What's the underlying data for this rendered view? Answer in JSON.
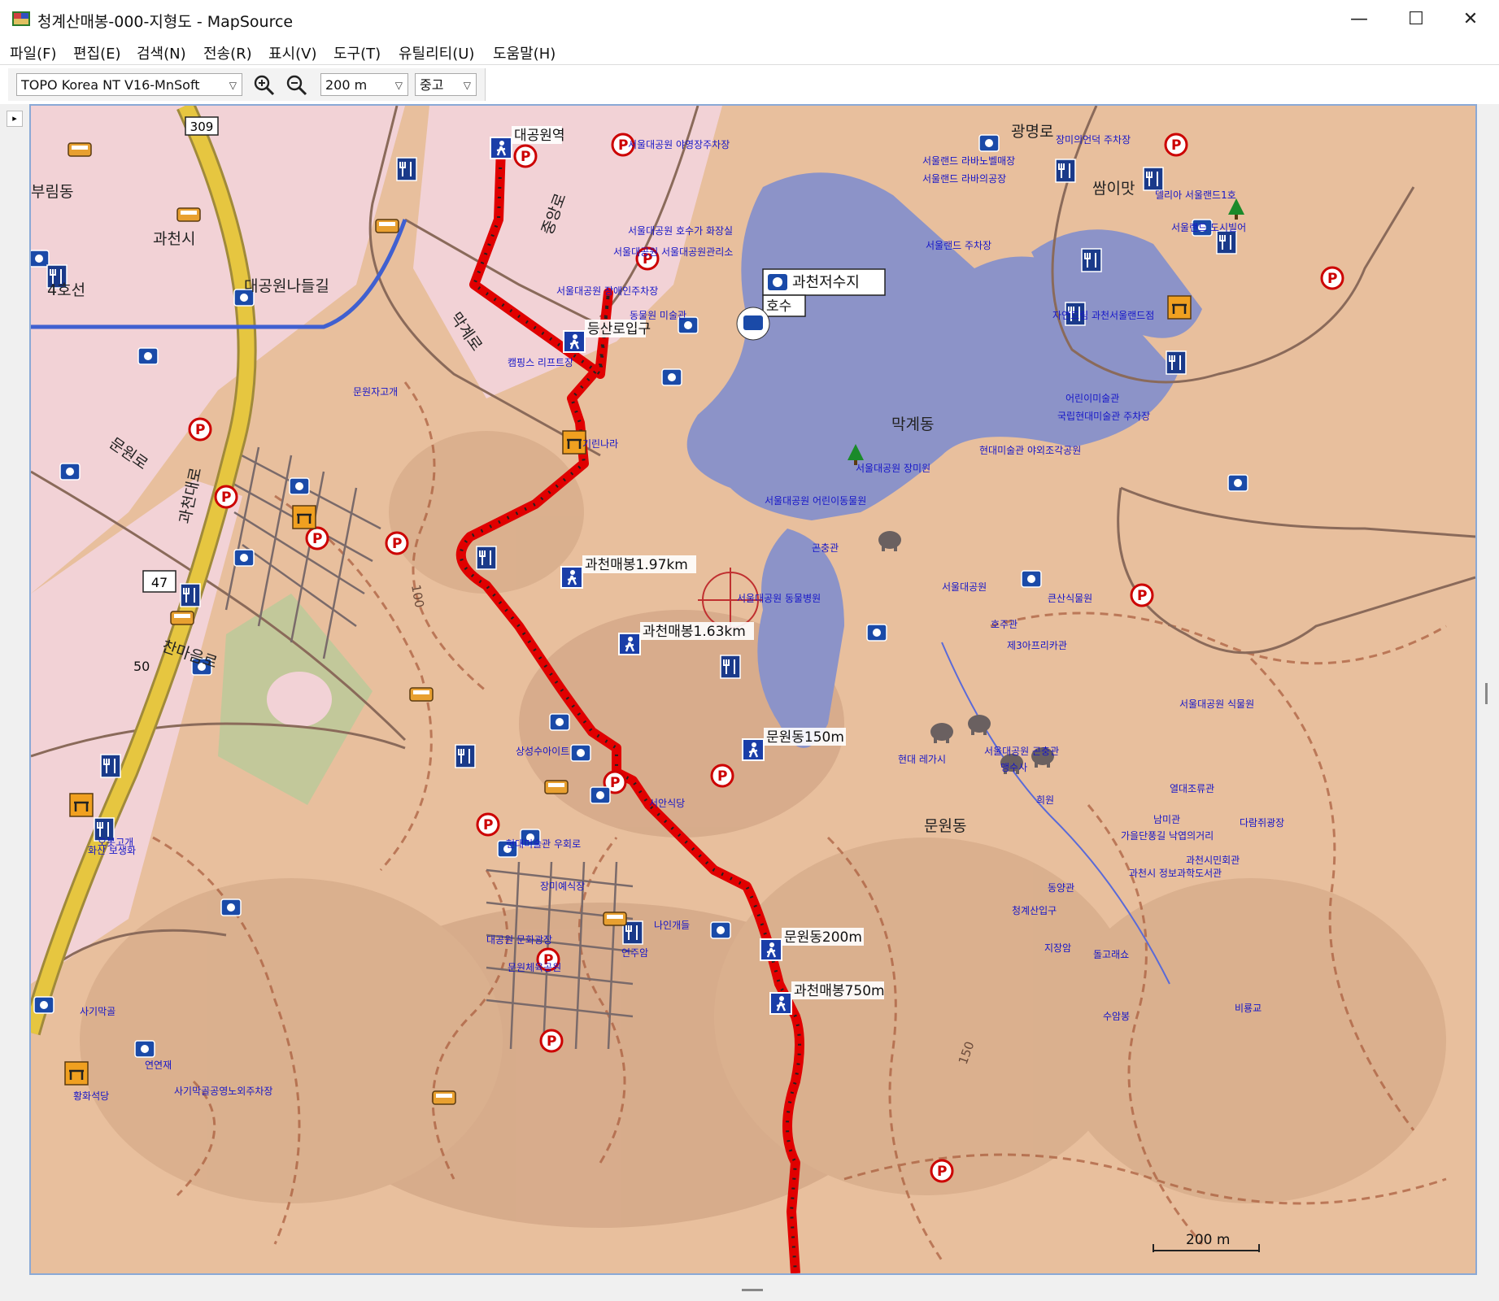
{
  "window": {
    "title": "청계산매봉-000-지형도 - MapSource",
    "minimize_glyph": "—",
    "maximize_glyph": "☐",
    "close_glyph": "✕"
  },
  "menu": [
    {
      "label": "파일(F)"
    },
    {
      "label": "편집(E)"
    },
    {
      "label": "검색(N)"
    },
    {
      "label": "전송(R)"
    },
    {
      "label": "표시(V)"
    },
    {
      "label": "도구(T)"
    },
    {
      "label": "유틸리티(U)"
    },
    {
      "label": "도움말(H)"
    }
  ],
  "toolbar": {
    "map_product": "TOPO Korea NT V16-MnSoft",
    "zoom_in_icon": "zoom-in-icon",
    "zoom_out_icon": "zoom-out-icon",
    "zoom_scale": "200 m",
    "detail_level": "중고"
  },
  "colors": {
    "terrain": "#e8bf9d",
    "urban": "#f2d2d6",
    "water": "#8c93c8",
    "track": "#e00000",
    "highway": "#e6c640",
    "subway": "#4060d0",
    "poi_text": "#1616c8"
  },
  "map": {
    "scale_label": "200 m",
    "waypoints": [
      {
        "label": "대공원역"
      },
      {
        "label": "등산로입구"
      },
      {
        "label": "과천매봉1.97km"
      },
      {
        "label": "과천매봉1.63km"
      },
      {
        "label": "문원동150m"
      },
      {
        "label": "문원동200m"
      },
      {
        "label": "과천매봉750m"
      }
    ],
    "callouts": [
      {
        "label": "과천저수지"
      },
      {
        "label": "호수"
      }
    ],
    "place_labels": [
      {
        "label": "과천시"
      },
      {
        "label": "부림동"
      },
      {
        "label": "막계동"
      },
      {
        "label": "문원동"
      },
      {
        "label": "광명로"
      },
      {
        "label": "쌈이맛"
      },
      {
        "label": "4호선"
      },
      {
        "label": "대공원나들길"
      },
      {
        "label": "과천대로"
      },
      {
        "label": "문원로"
      },
      {
        "label": "찬마음로"
      },
      {
        "label": "막계로"
      },
      {
        "label": "중앙로"
      }
    ],
    "route_shields": [
      {
        "label": "309"
      },
      {
        "label": "47"
      },
      {
        "label": "50"
      }
    ],
    "contour_labels": [
      {
        "label": "100"
      },
      {
        "label": "150"
      }
    ],
    "poi_labels": [
      {
        "label": "서울대공원 야영장주차장"
      },
      {
        "label": "서울대공원 호수가 화장실"
      },
      {
        "label": "서울대공원 서울대공원관리소"
      },
      {
        "label": "서울대공원 장애인주차장"
      },
      {
        "label": "동물원 미술관"
      },
      {
        "label": "캠핑스 리프트장"
      },
      {
        "label": "서울랜드 라바노벨매장"
      },
      {
        "label": "서울랜드 라바의공장"
      },
      {
        "label": "서울랜드 주차장"
      },
      {
        "label": "장미의언덕 주차장"
      },
      {
        "label": "델리아 서울랜드1호"
      },
      {
        "label": "서울랜드 도시빌어"
      },
      {
        "label": "자연드림 과천서울랜드점"
      },
      {
        "label": "어린이미술관"
      },
      {
        "label": "국립현대미술관 주차장"
      },
      {
        "label": "현대미술관 야외조각공원"
      },
      {
        "label": "서울대공원 장미원"
      },
      {
        "label": "서울대공원 어린이동물원"
      },
      {
        "label": "곤충관"
      },
      {
        "label": "서울대공원 동물병원"
      },
      {
        "label": "서울대공원"
      },
      {
        "label": "큰산식물원"
      },
      {
        "label": "호주관"
      },
      {
        "label": "제3아프리카관"
      },
      {
        "label": "서울대공원 식물원"
      },
      {
        "label": "열대조류관"
      },
      {
        "label": "맹수사"
      },
      {
        "label": "남미관"
      },
      {
        "label": "다람쥐광장"
      },
      {
        "label": "기린나라"
      },
      {
        "label": "문원자고개"
      },
      {
        "label": "상성수아이트"
      },
      {
        "label": "서안식당"
      },
      {
        "label": "장미예식장"
      },
      {
        "label": "화산 보생화"
      },
      {
        "label": "오봇고개"
      },
      {
        "label": "사기막골"
      },
      {
        "label": "연연재"
      },
      {
        "label": "황화석당"
      },
      {
        "label": "사기막골공영노외주차장"
      },
      {
        "label": "나인개들"
      },
      {
        "label": "연주암"
      },
      {
        "label": "문원체육공원"
      },
      {
        "label": "동양관"
      },
      {
        "label": "청계산입구"
      },
      {
        "label": "지장암"
      },
      {
        "label": "돌고래쇼"
      },
      {
        "label": "수암봉"
      },
      {
        "label": "비룡교"
      },
      {
        "label": "가을단풍길 낙엽의거리"
      },
      {
        "label": "희원"
      },
      {
        "label": "현대 레가시"
      },
      {
        "label": "서울대공원 곤충관"
      },
      {
        "label": "대공원 문화광장"
      },
      {
        "label": "현대미술관 우회로"
      },
      {
        "label": "과천시민회관"
      },
      {
        "label": "과천시 정보과학도서관"
      }
    ]
  }
}
